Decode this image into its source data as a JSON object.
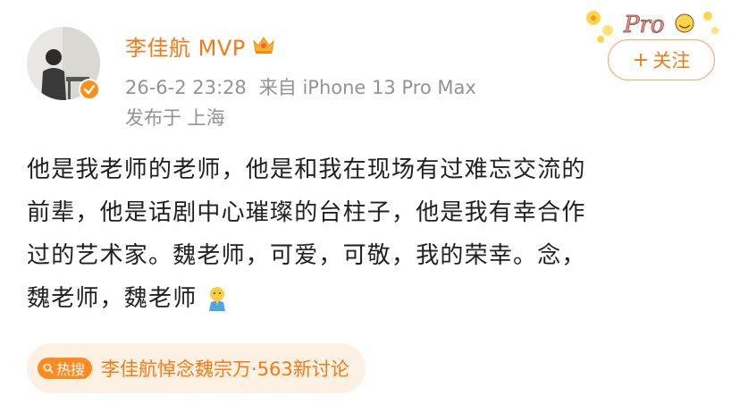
{
  "post": {
    "author_name": "李佳航",
    "badge_label": "MVP",
    "time": "26-6-2 23:28",
    "source": "来自 iPhone 13 Pro Max",
    "location": "发布于 上海",
    "follow_label": "关注",
    "lines": [
      "他是我老师的老师，他是和我在现场有过难忘交流的",
      "前辈，他是话剧中心璀璨的台柱子，他是我有幸合作",
      "过的艺术家。魏老师，可爱，可敬，我的荣幸。念，",
      "魏老师，魏老师"
    ]
  },
  "trend": {
    "badge": "热搜",
    "topic": "李佳航悼念魏宗万",
    "count": "·563新讨论"
  },
  "colors": {
    "accent": "#f57a13",
    "meta": "#939393",
    "text": "#202020",
    "trend_bg": "#fdf1e4"
  },
  "icons": [
    "avatar-photo",
    "verified-icon",
    "crown-icon",
    "decorative-sticker",
    "plus-icon",
    "praying-emoji-icon",
    "search-icon"
  ]
}
